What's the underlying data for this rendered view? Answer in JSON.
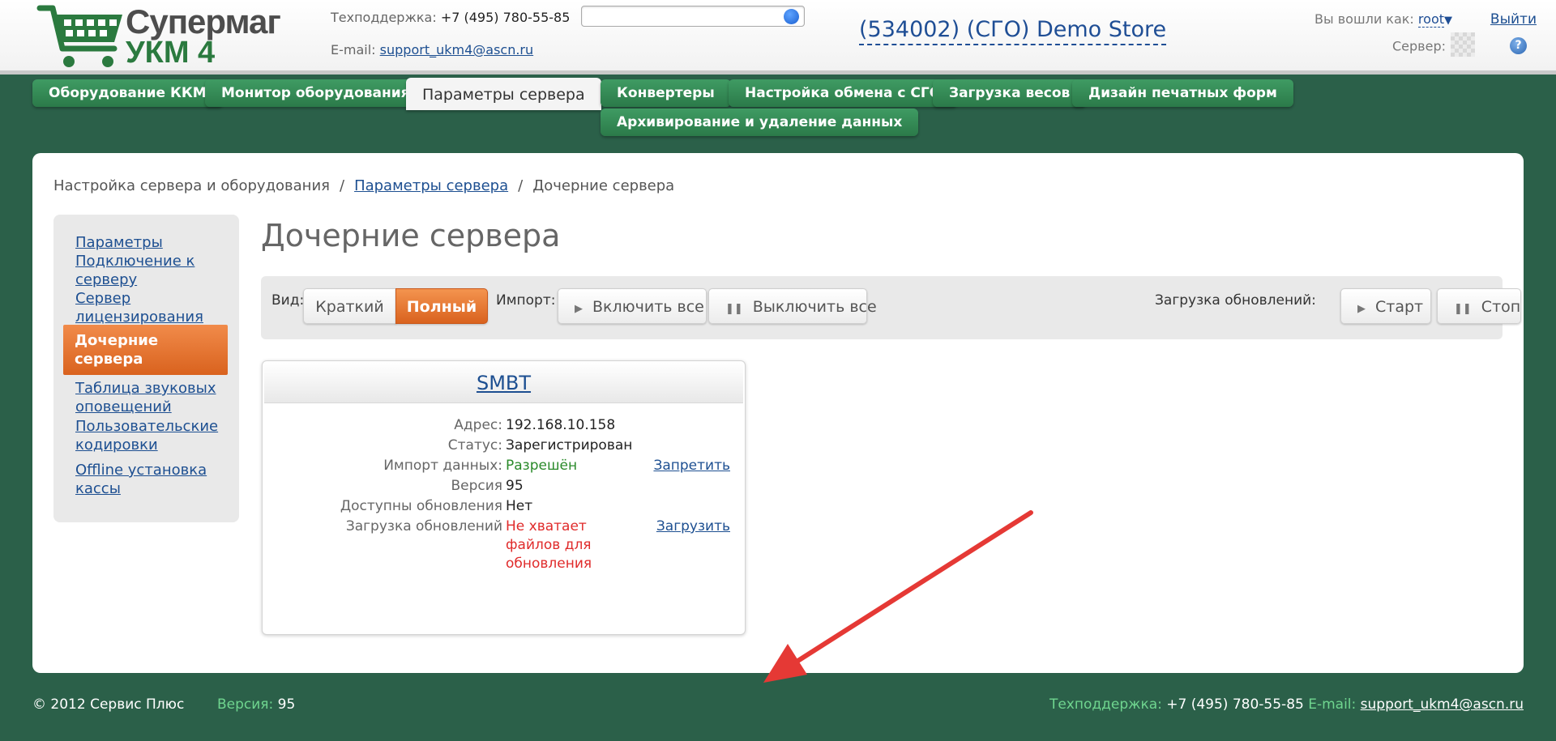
{
  "header": {
    "logo_line1": "Супермаг",
    "logo_line2": "УКМ 4",
    "support_label": "Техподдержка:",
    "support_phone": "+7 (495) 780-55-85",
    "email_label": "E-mail:",
    "email": "support_ukm4@ascn.ru",
    "search": {
      "value": "",
      "placeholder": ""
    },
    "store_title": "(534002) (СГО) Demo Store",
    "logged_in_label": "Вы вошли как:",
    "user": "root",
    "logout": "Выйти",
    "server_label": "Сервер:"
  },
  "nav": {
    "tabs": [
      {
        "label": "Оборудование ККМ",
        "active": false
      },
      {
        "label": "Монитор оборудования",
        "active": false
      },
      {
        "label": "Параметры сервера",
        "active": true
      },
      {
        "label": "Конвертеры",
        "active": false
      },
      {
        "label": "Настройка обмена с СГО",
        "active": false
      },
      {
        "label": "Загрузка весов",
        "active": false
      },
      {
        "label": "Дизайн печатных форм",
        "active": false
      },
      {
        "label": "Архивирование и удаление данных",
        "active": false
      }
    ]
  },
  "breadcrumb": {
    "root": "Настройка сервера и оборудования",
    "parent": "Параметры сервера",
    "current": "Дочерние сервера",
    "sep": "/"
  },
  "sidebar": {
    "items": [
      {
        "label": "Параметры"
      },
      {
        "label": "Подключение к серверу"
      },
      {
        "label": "Сервер лицензирования"
      },
      {
        "label": "Дочерние сервера",
        "active": true
      },
      {
        "label": "Таблица звуковых оповещений"
      },
      {
        "label": "Пользовательские кодировки"
      },
      {
        "label": "Offline установка кассы"
      }
    ]
  },
  "page_title": "Дочерние сервера",
  "toolbar": {
    "view_label": "Вид:",
    "view_short": "Краткий",
    "view_full": "Полный",
    "import_label": "Импорт:",
    "enable_all": "Включить все",
    "disable_all": "Выключить все",
    "updates_label": "Загрузка обновлений:",
    "start": "Старт",
    "stop": "Стоп"
  },
  "server_card": {
    "name": "SMBT",
    "rows": [
      {
        "label": "Адрес:",
        "value": "192.168.10.158"
      },
      {
        "label": "Статус:",
        "value": "Зарегистрирован"
      },
      {
        "label": "Импорт данных:",
        "value": "Разрешён",
        "action": "Запретить"
      },
      {
        "label": "Версия",
        "value": "95"
      },
      {
        "label": "Доступны обновления",
        "value": "Нет"
      },
      {
        "label": "Загрузка обновлений",
        "value": "Не хватает файлов для обновления",
        "action": "Загрузить"
      }
    ]
  },
  "footer": {
    "copyright": "© 2012 Сервис Плюс",
    "version_label": "Версия:",
    "version": "95",
    "support_label": "Техподдержка:",
    "support_phone": "+7 (495) 780-55-85",
    "email_label": "E-mail:",
    "email": "support_ukm4@ascn.ru"
  },
  "colors": {
    "background": "#2b6049",
    "tab_green": "#3f9b63",
    "accent_orange": "#e8702c",
    "link_blue": "#1d4f91",
    "annotation_red": "#e53935"
  },
  "icons": {
    "cart": "shopping-cart-icon",
    "search": "search-icon",
    "help": "help-icon",
    "play": "play-icon",
    "pause": "pause-icon"
  }
}
